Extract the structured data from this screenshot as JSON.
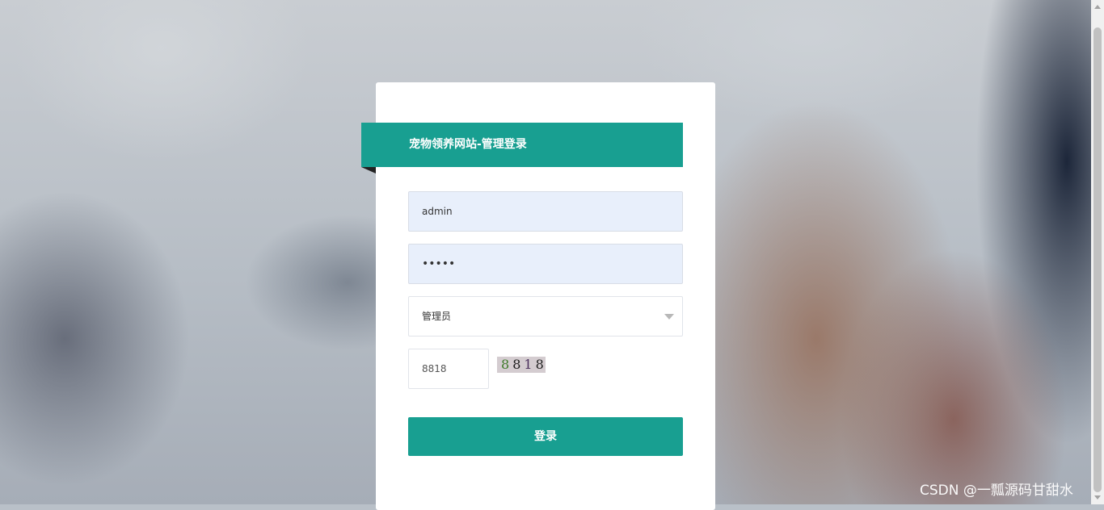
{
  "header": {
    "title": "宠物领养网站-管理登录"
  },
  "form": {
    "username_value": "admin",
    "password_masked": "•••••",
    "role_selected": "管理员",
    "verify_code_value": "8818",
    "captcha_digits": [
      "8",
      "8",
      "1",
      "8"
    ],
    "login_button_label": "登录"
  },
  "watermark": "CSDN @一瓢源码甘甜水",
  "colors": {
    "accent": "#189f91",
    "input_fill": "#e8effb"
  }
}
